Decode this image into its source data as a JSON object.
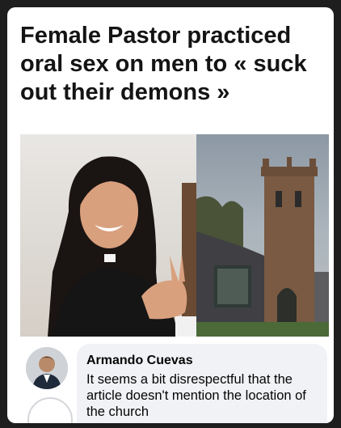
{
  "post": {
    "headline": "Female Pastor practiced oral sex on men to « suck out their demons »"
  },
  "photos": {
    "left_icon": "woman-photo",
    "right_icon": "church-photo"
  },
  "comment": {
    "author": "Armando Cuevas",
    "text": "It seems a bit disrespectful that the article doesn't mention the location of the church",
    "avatar_icon": "avatar-icon"
  },
  "colors": {
    "card": "#ffffff",
    "bubble": "#f0f2f5",
    "text": "#050505"
  }
}
